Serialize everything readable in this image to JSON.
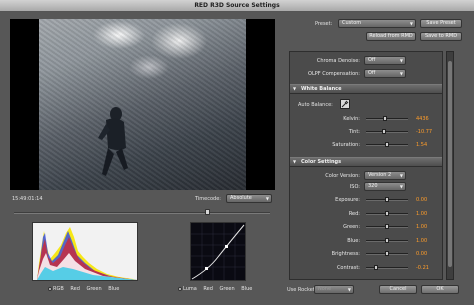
{
  "window": {
    "title": "RED R3D Source Settings"
  },
  "video": {
    "timecode": "15:49:01:14"
  },
  "timecode_selector": {
    "label": "Timecode:",
    "value": "Absolute"
  },
  "histogram": {
    "legend": [
      "RGB",
      "Red",
      "Green",
      "Blue"
    ]
  },
  "curves": {
    "legend": [
      "Luma",
      "Red",
      "Green",
      "Blue"
    ]
  },
  "preset": {
    "label": "Preset:",
    "value": "Custom",
    "save_preset": "Save Preset",
    "reload": "Reload from RMD",
    "save_rmd": "Save to RMD"
  },
  "chroma_denoise": {
    "label": "Chroma Denoise:",
    "value": "Off"
  },
  "olpf_compensation": {
    "label": "OLPF Compensation:",
    "value": "Off"
  },
  "white_balance": {
    "header": "White Balance",
    "auto_balance_label": "Auto Balance:",
    "sliders": [
      {
        "label": "Kelvin:",
        "value": "4436",
        "level": 0.44
      },
      {
        "label": "Tint:",
        "value": "-10.77",
        "level": 0.42
      },
      {
        "label": "Saturation:",
        "value": "1.54",
        "level": 0.5
      }
    ]
  },
  "color_settings": {
    "header": "Color Settings",
    "color_version_label": "Color Version:",
    "color_version": "Version 2",
    "iso_label": "ISO:",
    "iso": "320",
    "sliders": [
      {
        "label": "Exposure:",
        "value": "0.00",
        "level": 0.5
      },
      {
        "label": "Red:",
        "value": "1.00",
        "level": 0.5
      },
      {
        "label": "Green:",
        "value": "1.00",
        "level": 0.5
      },
      {
        "label": "Blue:",
        "value": "1.00",
        "level": 0.5
      },
      {
        "label": "Brightness:",
        "value": "0.00",
        "level": 0.5
      },
      {
        "label": "Contrast:",
        "value": "-0.21",
        "level": 0.2
      }
    ]
  },
  "footer": {
    "use_rocket_label": "Use Rocket:",
    "use_rocket_value": "None",
    "cancel": "Cancel",
    "ok": "OK"
  },
  "colors": {
    "accent_value": "#ff9d2a",
    "panel": "#4b4b4b",
    "window": "#575757"
  }
}
